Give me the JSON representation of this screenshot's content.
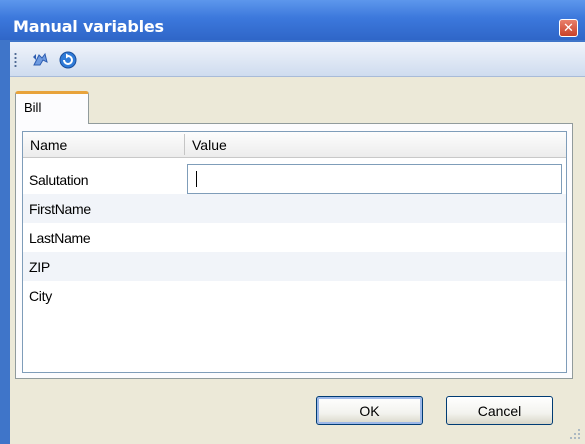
{
  "window": {
    "title": "Manual variables",
    "close_glyph": "✕"
  },
  "toolbar": {
    "icons": [
      "undo-icon",
      "refresh-icon"
    ]
  },
  "tabs": [
    {
      "label": "Bill",
      "selected": true
    }
  ],
  "grid": {
    "columns": [
      "Name",
      "Value"
    ],
    "rows": [
      {
        "name": "Salutation",
        "value": ""
      },
      {
        "name": "FirstName",
        "value": ""
      },
      {
        "name": "LastName",
        "value": ""
      },
      {
        "name": "ZIP",
        "value": ""
      },
      {
        "name": "City",
        "value": ""
      }
    ]
  },
  "buttons": {
    "ok_label": "OK",
    "cancel_label": "Cancel"
  },
  "colors": {
    "titlebar": "#3c78dc",
    "tab_accent": "#e8a33b",
    "close": "#c9412a"
  }
}
